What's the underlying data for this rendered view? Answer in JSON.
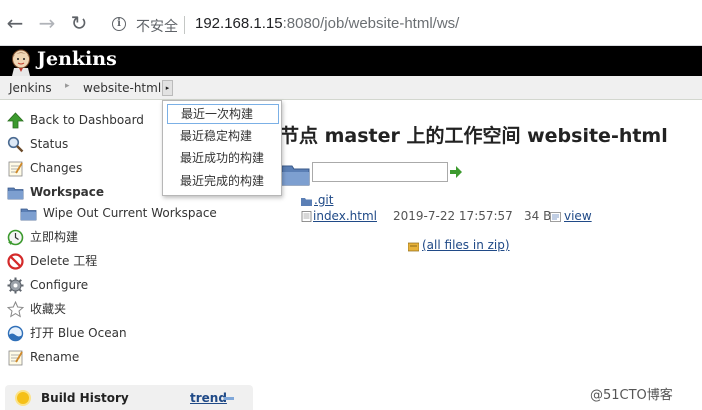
{
  "browser": {
    "insecure_label": "不安全",
    "url_host": "192.168.1.15",
    "url_rest": ":8080/job/website-html/ws/"
  },
  "header": {
    "title": "Jenkins"
  },
  "breadcrumb": {
    "items": [
      "Jenkins",
      "website-html"
    ],
    "menu_arrow": "▸"
  },
  "dropdown": {
    "items": [
      "最近一次构建",
      "最近稳定构建",
      "最近成功的构建",
      "最近完成的构建"
    ]
  },
  "sidebar": {
    "items": [
      {
        "label": "Back to Dashboard",
        "icon": "up-arrow-icon"
      },
      {
        "label": "Status",
        "icon": "search-icon"
      },
      {
        "label": "Changes",
        "icon": "notepad-icon"
      },
      {
        "label": "Workspace",
        "icon": "folder-icon"
      },
      {
        "label": "Wipe Out Current Workspace",
        "icon": "folder-icon"
      },
      {
        "label": "立即构建",
        "icon": "clock-icon"
      },
      {
        "label": "Delete 工程",
        "icon": "no-entry-icon"
      },
      {
        "label": "Configure",
        "icon": "gear-icon"
      },
      {
        "label": "收藏夹",
        "icon": "star-icon"
      },
      {
        "label": "打开 Blue Ocean",
        "icon": "blue-ocean-icon"
      },
      {
        "label": "Rename",
        "icon": "notepad-icon"
      }
    ]
  },
  "build_history": {
    "title": "Build History",
    "trend_label": "trend"
  },
  "main": {
    "title": "节点 master 上的工作空间 website-html",
    "files": [
      {
        "name": ".git",
        "date": "",
        "size": "",
        "view": ""
      },
      {
        "name": "index.html",
        "date": "2019-7-22 17:57:57",
        "size": "34 B",
        "view": "view"
      }
    ],
    "zip_label": "(all files in zip)"
  },
  "watermark": "@51CTO博客"
}
